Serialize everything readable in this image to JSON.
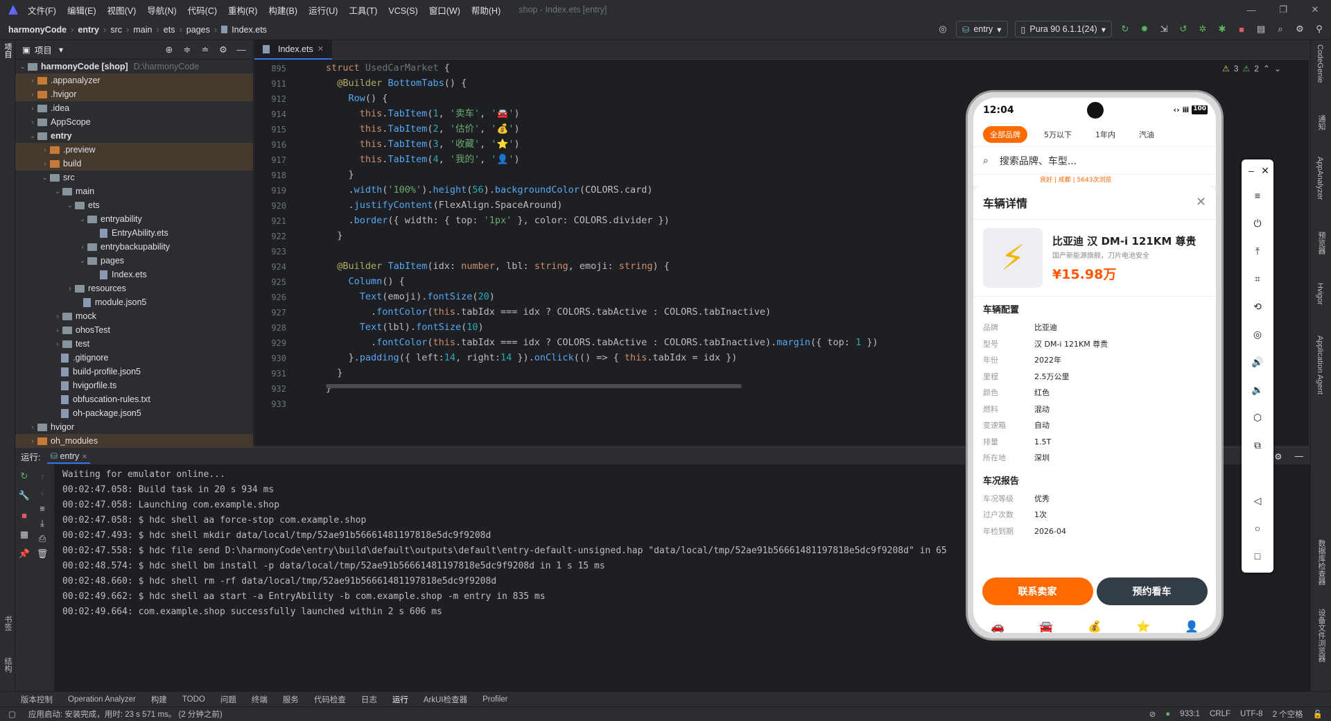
{
  "titlebar": {
    "menus": [
      "文件(F)",
      "编辑(E)",
      "视图(V)",
      "导航(N)",
      "代码(C)",
      "重构(R)",
      "构建(B)",
      "运行(U)",
      "工具(T)",
      "VCS(S)",
      "窗口(W)",
      "帮助(H)"
    ],
    "window_title": "shop - Index.ets [entry]"
  },
  "breadcrumb": [
    "harmonyCode",
    "entry",
    "src",
    "main",
    "ets",
    "pages",
    "Index.ets"
  ],
  "toolbar": {
    "run_config": "entry",
    "device": "Pura 90 6.1.1(24)",
    "warnings": "3",
    "weak_warnings": "2"
  },
  "project": {
    "title": "项目",
    "root": "harmonyCode [shop]",
    "root_path": "D:\\harmonyCode",
    "items": [
      ".appanalyzer",
      ".hvigor",
      ".idea",
      "AppScope",
      "entry",
      ".preview",
      "build",
      "src",
      "main",
      "ets",
      "entryability",
      "EntryAbility.ets",
      "entrybackupability",
      "pages",
      "Index.ets",
      "resources",
      "module.json5",
      "mock",
      "ohosTest",
      "test",
      ".gitignore",
      "build-profile.json5",
      "hvigorfile.ts",
      "obfuscation-rules.txt",
      "oh-package.json5",
      "hvigor",
      "oh_modules"
    ]
  },
  "editor": {
    "tab": "Index.ets",
    "line_numbers": [
      "895",
      "911",
      "912",
      "914",
      "915",
      "916",
      "917",
      "918",
      "919",
      "920",
      "921",
      "922",
      "923",
      "924",
      "925",
      "926",
      "927",
      "928",
      "929",
      "930",
      "931",
      "932",
      "933"
    ]
  },
  "run": {
    "label": "运行:",
    "config": "entry",
    "lines": [
      "Waiting for emulator online...",
      "",
      "00:02:47.058: Build task in 20 s 934 ms",
      "00:02:47.058: Launching com.example.shop",
      "00:02:47.058: $ hdc shell aa force-stop com.example.shop",
      "00:02:47.493: $ hdc shell mkdir data/local/tmp/52ae91b56661481197818e5dc9f9208d",
      "00:02:47.558: $ hdc file send D:\\harmonyCode\\entry\\build\\default\\outputs\\default\\entry-default-unsigned.hap \"data/local/tmp/52ae91b56661481197818e5dc9f9208d\" in 65",
      "00:02:48.574: $ hdc shell bm install -p data/local/tmp/52ae91b56661481197818e5dc9f9208d in 1 s 15 ms",
      "00:02:48.660: $ hdc shell rm -rf data/local/tmp/52ae91b56661481197818e5dc9f9208d",
      "00:02:49.662: $ hdc shell aa start -a EntryAbility -b com.example.shop -m entry in 835 ms",
      "00:02:49.664: com.example.shop successfully launched within 2 s 606 ms"
    ]
  },
  "bottom_tools": [
    "版本控制",
    "Operation Analyzer",
    "构建",
    "TODO",
    "问题",
    "终端",
    "服务",
    "代码检查",
    "日志",
    "运行",
    "ArkUI检查器",
    "Profiler"
  ],
  "status": {
    "message": "应用启动: 安装完成，用时: 23 s 571 ms。 (2 分钟之前)",
    "position": "933:1",
    "line_sep": "CRLF",
    "encoding": "UTF-8",
    "indent": "2 个空格"
  },
  "left_strip": [
    "项目",
    "书签",
    "结构"
  ],
  "right_strip": [
    "CodeGenie",
    "通知",
    "AppAnalyzer",
    "预览器",
    "Hvigor",
    "Application Agent",
    "数据库检查器",
    "设备文件浏览器"
  ],
  "phone": {
    "time": "12:04",
    "chips": [
      "全部品牌",
      "5万以下",
      "1年内",
      "汽油"
    ],
    "search_placeholder": "搜索品牌、车型...",
    "sheet_title": "车辆详情",
    "car_title": "比亚迪 汉 DM-i 121KM 尊贵",
    "car_sub": "国产新能源旗舰，刀片电池安全",
    "car_price": "¥15.98万",
    "config_title": "车辆配置",
    "config": [
      [
        "品牌",
        "比亚迪"
      ],
      [
        "型号",
        "汉 DM-i 121KM 尊贵"
      ],
      [
        "年份",
        "2022年"
      ],
      [
        "里程",
        "2.5万公里"
      ],
      [
        "颜色",
        "红色"
      ],
      [
        "燃料",
        "混动"
      ],
      [
        "变速箱",
        "自动"
      ],
      [
        "排量",
        "1.5T"
      ],
      [
        "所在地",
        "深圳"
      ]
    ],
    "report_title": "车况报告",
    "report": [
      [
        "车况等级",
        "优秀"
      ],
      [
        "过户次数",
        "1次"
      ],
      [
        "年检到期",
        "2026-04"
      ]
    ],
    "btn_contact": "联系卖家",
    "btn_book": "预约看车",
    "peek_text": "良好 | 成都 | 5643次浏览"
  }
}
